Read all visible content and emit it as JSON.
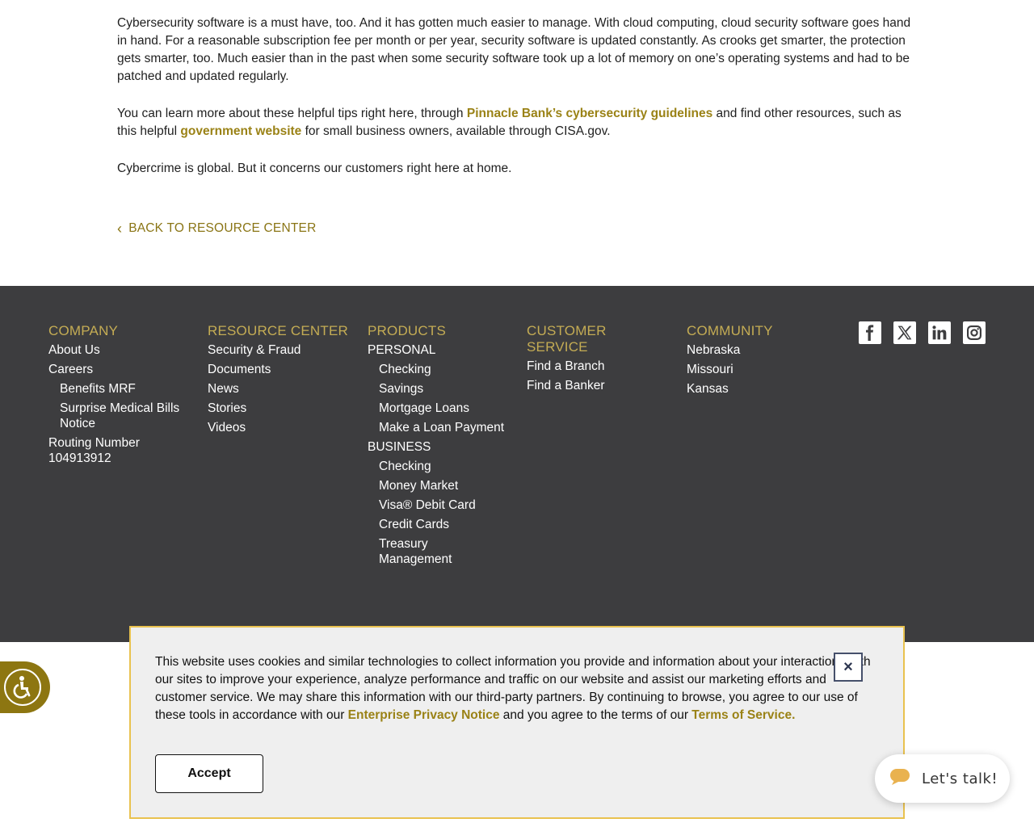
{
  "article": {
    "p1": "Cybersecurity software is a must have, too. And it has gotten much easier to manage. With cloud computing, cloud security software goes hand in hand. For a reasonable subscription fee per month or per year, security software is updated constantly. As crooks get smarter, the protection gets smarter, too. Much easier than in the past when some security software took up a lot of memory on one’s operating systems and had to be patched and updated regularly.",
    "p2_a": "You can learn more about these helpful tips right here, through ",
    "p2_link1": "Pinnacle Bank’s cybersecurity guidelines",
    "p2_b": " and find other resources, such as this helpful ",
    "p2_link2": "government website",
    "p2_c": " for small business owners, available through CISA.gov.",
    "p3": "Cybercrime is global. But it concerns our customers right here at home.",
    "back_label": "BACK TO RESOURCE CENTER"
  },
  "footer": {
    "company": {
      "heading": "COMPANY",
      "about": "About Us",
      "careers": "Careers",
      "benefits": "Benefits MRF",
      "surprise": "Surprise Medical Bills Notice",
      "routing": "Routing Number 104913912"
    },
    "resource_center": {
      "heading": "RESOURCE CENTER",
      "items": [
        "Security & Fraud",
        "Documents",
        "News",
        "Stories",
        "Videos"
      ]
    },
    "products": {
      "heading": "PRODUCTS",
      "personal_label": "PERSONAL",
      "personal": [
        "Checking",
        "Savings",
        "Mortgage Loans",
        "Make a Loan Payment"
      ],
      "business_label": "BUSINESS",
      "business": [
        "Checking",
        "Money Market",
        "Visa® Debit Card",
        "Credit Cards",
        "Treasury Management"
      ]
    },
    "customer_service": {
      "heading": "CUSTOMER SERVICE",
      "items": [
        "Find a Branch",
        "Find a Banker"
      ]
    },
    "community": {
      "heading": "COMMUNITY",
      "items": [
        "Nebraska",
        "Missouri",
        "Kansas"
      ]
    },
    "social_icons": [
      "facebook-icon",
      "x-icon",
      "linkedin-icon",
      "instagram-icon"
    ]
  },
  "cookie": {
    "text_a": "This website uses cookies and similar technologies to collect information you provide and information about your interactions with our sites to improve your experience, analyze performance and traffic on our website and assist our marketing efforts and customer service. We may share this information with our third-party partners. By continuing to browse, you agree to our use of these tools in accordance with our ",
    "privacy_link": "Enterprise Privacy Notice",
    "text_b": " and you agree to the terms of our ",
    "terms_link": "Terms of Service.",
    "close_label": "×",
    "accept_label": "Accept"
  },
  "chat": {
    "label": "Let's talk!"
  },
  "colors": {
    "gold": "#9a8216",
    "footer_bg": "#3d3d3f",
    "footer_heading": "#c4ac54",
    "cookie_border": "#e9c24f",
    "a11y_bg": "#8d7611"
  }
}
